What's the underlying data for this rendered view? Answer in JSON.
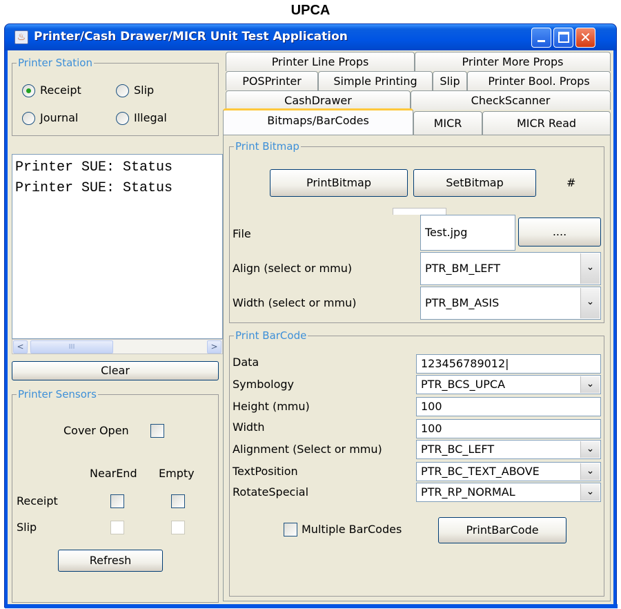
{
  "figure_title": "UPCA",
  "window": {
    "title": "Printer/Cash Drawer/MICR Unit Test Application",
    "icon": "java-cup-icon",
    "controls": {
      "minimize": "minimize-icon",
      "maximize": "maximize-icon",
      "close": "close-icon",
      "close_glyph": "✕"
    }
  },
  "printer_station": {
    "legend": "Printer Station",
    "options": [
      {
        "label": "Receipt",
        "selected": true
      },
      {
        "label": "Slip",
        "selected": false
      },
      {
        "label": "Journal",
        "selected": false
      },
      {
        "label": "Illegal",
        "selected": false
      }
    ]
  },
  "log": {
    "lines": [
      "Printer SUE: Status",
      "Printer SUE: Status"
    ],
    "scroll_left": "<",
    "scroll_right": ">",
    "thumb_grip": "III"
  },
  "clear_label": "Clear",
  "printer_sensors": {
    "legend": "Printer Sensors",
    "cover_open": "Cover Open",
    "col_nearend": "NearEnd",
    "col_empty": "Empty",
    "row_receipt": "Receipt",
    "row_slip": "Slip",
    "refresh_label": "Refresh"
  },
  "tabs": {
    "row1": [
      "Printer Line Props",
      "Printer More Props"
    ],
    "row2": [
      "POSPrinter",
      "Simple Printing",
      "Slip",
      "Printer Bool. Props"
    ],
    "row3": [
      "CashDrawer",
      "CheckScanner"
    ],
    "row4": [
      "Bitmaps/BarCodes",
      "MICR",
      "MICR Read"
    ],
    "active": "Bitmaps/BarCodes"
  },
  "print_bitmap": {
    "legend": "Print Bitmap",
    "print_bitmap_label": "PrintBitmap",
    "set_bitmap_label": "SetBitmap",
    "hash_label": "#",
    "file_label": "File",
    "file_value": "Test.jpg",
    "browse_label": "....",
    "align_label": "Align (select or mmu)",
    "align_value": "PTR_BM_LEFT",
    "width_label": "Width (select or mmu)",
    "width_value": "PTR_BM_ASIS"
  },
  "print_barcode": {
    "legend": "Print BarCode",
    "data_label": "Data",
    "data_value": "123456789012|",
    "symbology_label": "Symbology",
    "symbology_value": "PTR_BCS_UPCA",
    "height_label": "Height (mmu)",
    "height_value": "100",
    "width_label": "Width",
    "width_value": "100",
    "alignment_label": "Alignment (Select or mmu)",
    "alignment_value": "PTR_BC_LEFT",
    "textpos_label": "TextPosition",
    "textpos_value": "PTR_BC_TEXT_ABOVE",
    "rotate_label": "RotateSpecial",
    "rotate_value": "PTR_RP_NORMAL",
    "multiple_label": "Multiple BarCodes",
    "print_label": "PrintBarCode",
    "dropdown_glyph": "⌄"
  }
}
